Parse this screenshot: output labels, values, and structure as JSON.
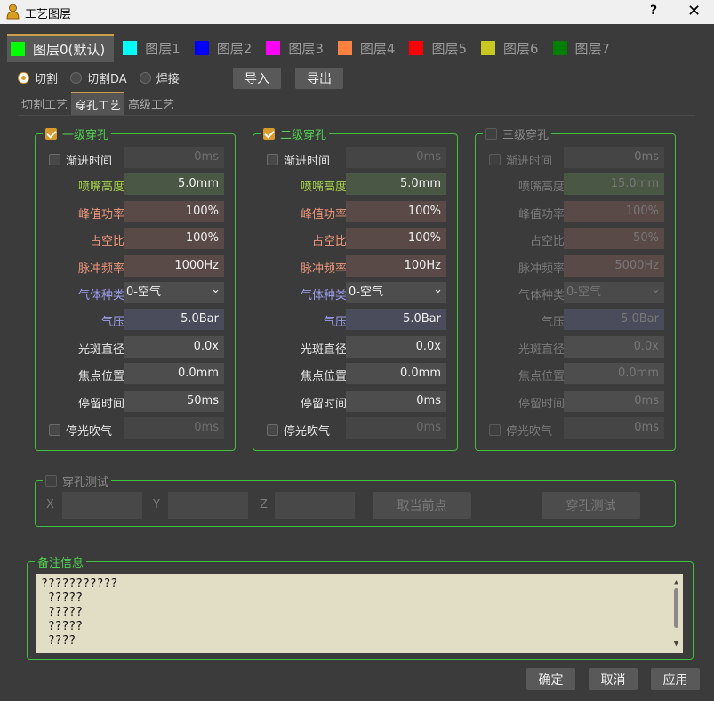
{
  "window": {
    "title": "工艺图层",
    "help": "?",
    "close": "✕"
  },
  "layers": [
    {
      "label": "图层0(默认)",
      "color": "#00ff00",
      "active": true
    },
    {
      "label": "图层1",
      "color": "#00ffff"
    },
    {
      "label": "图层2",
      "color": "#0000ff"
    },
    {
      "label": "图层3",
      "color": "#ff00ff"
    },
    {
      "label": "图层4",
      "color": "#ff8040"
    },
    {
      "label": "图层5",
      "color": "#ff0000"
    },
    {
      "label": "图层6",
      "color": "#c8c820"
    },
    {
      "label": "图层7",
      "color": "#008000"
    }
  ],
  "modes": {
    "cut": "切割",
    "cut_da": "切割DA",
    "weld": "焊接",
    "selected": "cut"
  },
  "buttons": {
    "import": "导入",
    "export": "导出",
    "ok": "确定",
    "cancel": "取消",
    "apply": "应用"
  },
  "sub_tabs": {
    "cutting": "切割工艺",
    "piercing": "穿孔工艺",
    "advanced": "高级工艺",
    "active": "piercing"
  },
  "labels": {
    "ramp_time": "渐进时间",
    "nozzle_height": "喷嘴高度",
    "peak_power": "峰值功率",
    "duty_cycle": "占空比",
    "pulse_freq": "脉冲频率",
    "gas_type": "气体种类",
    "pressure": "气压",
    "spot_diameter": "光斑直径",
    "focus_position": "焦点位置",
    "dwell_time": "停留时间",
    "stop_blow": "停光吹气"
  },
  "pierce_groups": [
    {
      "title": "一级穿孔",
      "enabled": true,
      "ramp_time": "0ms",
      "nozzle_height": "5.0mm",
      "peak_power": "100%",
      "duty_cycle": "100%",
      "pulse_freq": "1000Hz",
      "gas_type": "0-空气",
      "pressure": "5.0Bar",
      "spot_diameter": "0.0x",
      "focus_position": "0.0mm",
      "dwell_time": "50ms",
      "stop_blow": "0ms"
    },
    {
      "title": "二级穿孔",
      "enabled": true,
      "ramp_time": "0ms",
      "nozzle_height": "5.0mm",
      "peak_power": "100%",
      "duty_cycle": "100%",
      "pulse_freq": "100Hz",
      "gas_type": "0-空气",
      "pressure": "5.0Bar",
      "spot_diameter": "0.0x",
      "focus_position": "0.0mm",
      "dwell_time": "0ms",
      "stop_blow": "0ms"
    },
    {
      "title": "三级穿孔",
      "enabled": false,
      "ramp_time": "0ms",
      "nozzle_height": "15.0mm",
      "peak_power": "100%",
      "duty_cycle": "50%",
      "pulse_freq": "5000Hz",
      "gas_type": "0-空气",
      "pressure": "5.0Bar",
      "spot_diameter": "0.0x",
      "focus_position": "0.0mm",
      "dwell_time": "0ms",
      "stop_blow": "0ms"
    }
  ],
  "pierce_test": {
    "title": "穿孔测试",
    "x_label": "X",
    "y_label": "Y",
    "z_label": "Z",
    "take_current": "取当前点",
    "test_button": "穿孔测试"
  },
  "notes": {
    "title": "备注信息",
    "lines": [
      "???????????",
      " ?????",
      " ?????",
      " ?????",
      " ????"
    ]
  }
}
